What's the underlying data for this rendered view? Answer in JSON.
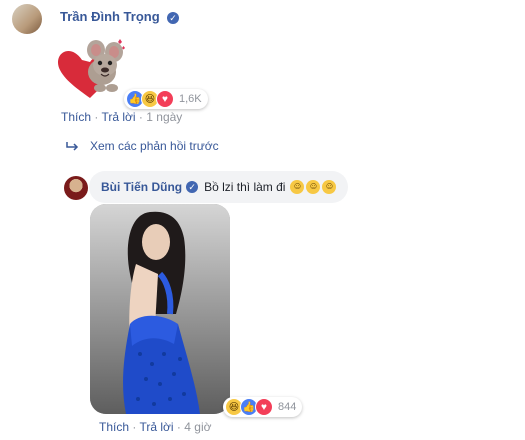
{
  "comment1": {
    "author": "Trần Đình Trọng",
    "reactions": {
      "count": "1,6K",
      "icons": [
        "like-icon",
        "haha-icon",
        "love-icon"
      ]
    },
    "actions": {
      "like": "Thích",
      "reply": "Trả lời",
      "time": "1 ngày"
    }
  },
  "view_previous": {
    "label": "Xem các phản hồi trước"
  },
  "comment2": {
    "author": "Bùi Tiến Dũng",
    "text": "Bồ lzi thì làm đi",
    "emojis": [
      "😊",
      "😊",
      "😊"
    ],
    "reactions": {
      "count": "844",
      "icons": [
        "haha-icon",
        "like-icon",
        "love-icon"
      ]
    },
    "actions": {
      "like": "Thích",
      "reply": "Trả lời",
      "time": "4 giờ"
    }
  },
  "colors": {
    "link": "#385898",
    "verified": "#4267b2",
    "bubble": "#f2f3f5"
  }
}
